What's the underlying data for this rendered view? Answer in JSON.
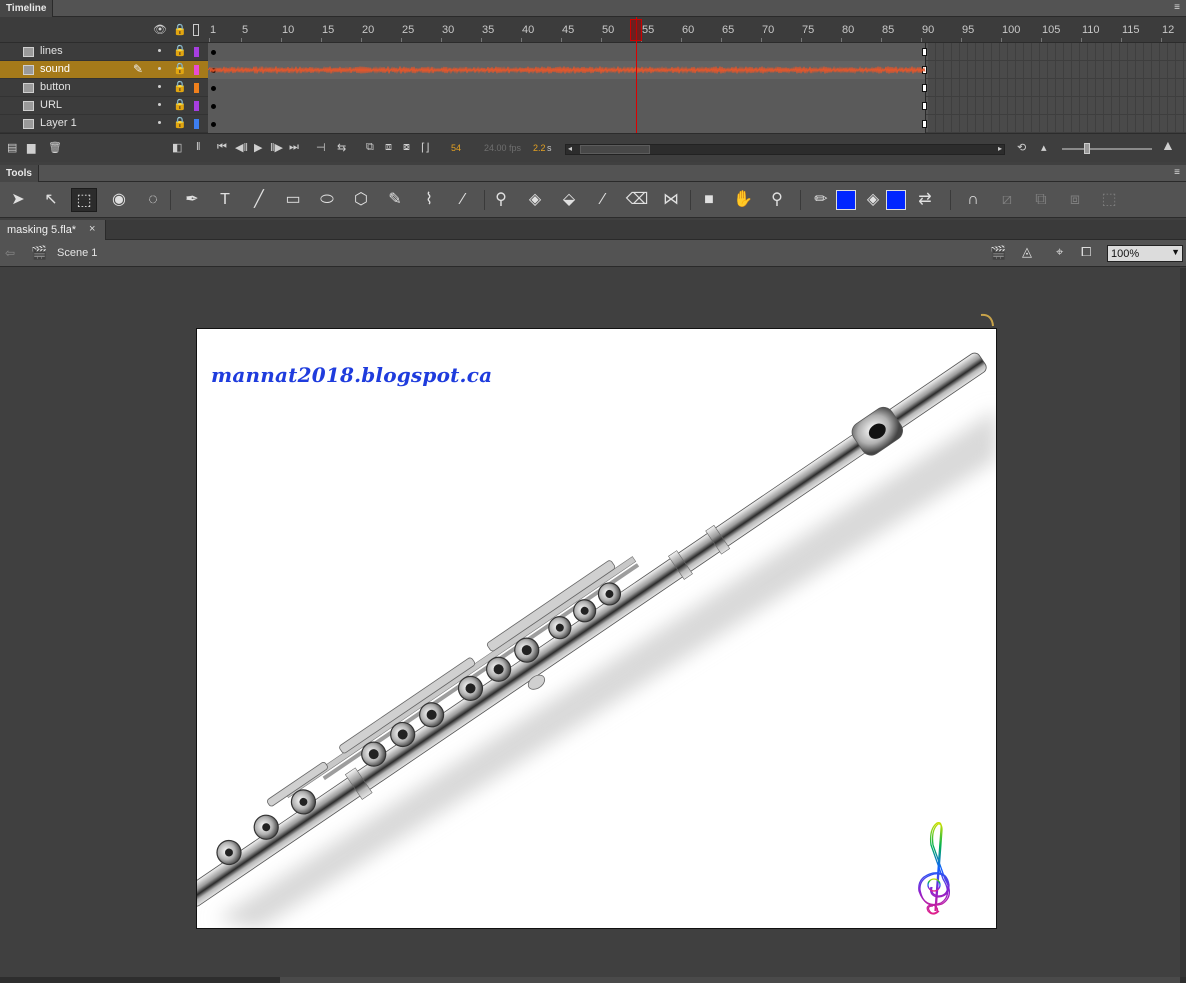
{
  "timeline": {
    "title": "Timeline",
    "ruler_ticks": [
      "1",
      "5",
      "10",
      "15",
      "20",
      "25",
      "30",
      "35",
      "40",
      "45",
      "50",
      "55",
      "60",
      "65",
      "70",
      "75",
      "80",
      "85",
      "90",
      "95",
      "100",
      "105",
      "110",
      "115",
      "12"
    ],
    "layers": [
      {
        "name": "lines",
        "color": "#a73ee0",
        "selected": false
      },
      {
        "name": "sound",
        "color": "#e84bd5",
        "selected": true
      },
      {
        "name": "button",
        "color": "#f0801c",
        "selected": false
      },
      {
        "name": "URL",
        "color": "#a73ee0",
        "selected": false
      },
      {
        "name": "Layer 1",
        "color": "#3d7ef0",
        "selected": false
      }
    ],
    "current_frame": "54",
    "fps": "24.00 fps",
    "time": "2.2",
    "time_unit": "s",
    "total_frames": 90,
    "playhead_frame": 54
  },
  "tools": {
    "title": "Tools",
    "items": [
      {
        "name": "selection-tool",
        "glyph": "➤"
      },
      {
        "name": "subselection-tool",
        "glyph": "↖"
      },
      {
        "name": "free-transform-tool",
        "glyph": "⬚",
        "active": true
      },
      {
        "name": "3d-rotation-tool",
        "glyph": "◉"
      },
      {
        "name": "lasso-tool",
        "glyph": "◌"
      },
      {
        "name": "pen-tool",
        "glyph": "✒"
      },
      {
        "name": "text-tool",
        "glyph": "T"
      },
      {
        "name": "line-tool",
        "glyph": "╱"
      },
      {
        "name": "rectangle-tool",
        "glyph": "▭"
      },
      {
        "name": "oval-tool",
        "glyph": "⬭"
      },
      {
        "name": "polystar-tool",
        "glyph": "⬡"
      },
      {
        "name": "pencil-tool",
        "glyph": "✎"
      },
      {
        "name": "paint-brush-tool",
        "glyph": "⌇"
      },
      {
        "name": "brush-tool",
        "glyph": "∕"
      },
      {
        "name": "bone-tool",
        "glyph": "⚲"
      },
      {
        "name": "paint-bucket-tool",
        "glyph": "◈"
      },
      {
        "name": "ink-bottle-tool",
        "glyph": "⬙"
      },
      {
        "name": "eyedropper-tool",
        "glyph": "⁄"
      },
      {
        "name": "eraser-tool",
        "glyph": "⌫"
      },
      {
        "name": "width-tool",
        "glyph": "⋈"
      },
      {
        "name": "camera-tool",
        "glyph": "■"
      },
      {
        "name": "hand-tool",
        "glyph": "✋"
      },
      {
        "name": "zoom-tool",
        "glyph": "⚲"
      }
    ],
    "stroke_color": "#0026ff",
    "fill_color": "#0026ff"
  },
  "document": {
    "tab_label": "masking 5.fla*",
    "close_glyph": "×",
    "scene": "Scene 1",
    "zoom": "100%"
  },
  "stage": {
    "url_text": "mannat2018.blogspot.ca"
  }
}
